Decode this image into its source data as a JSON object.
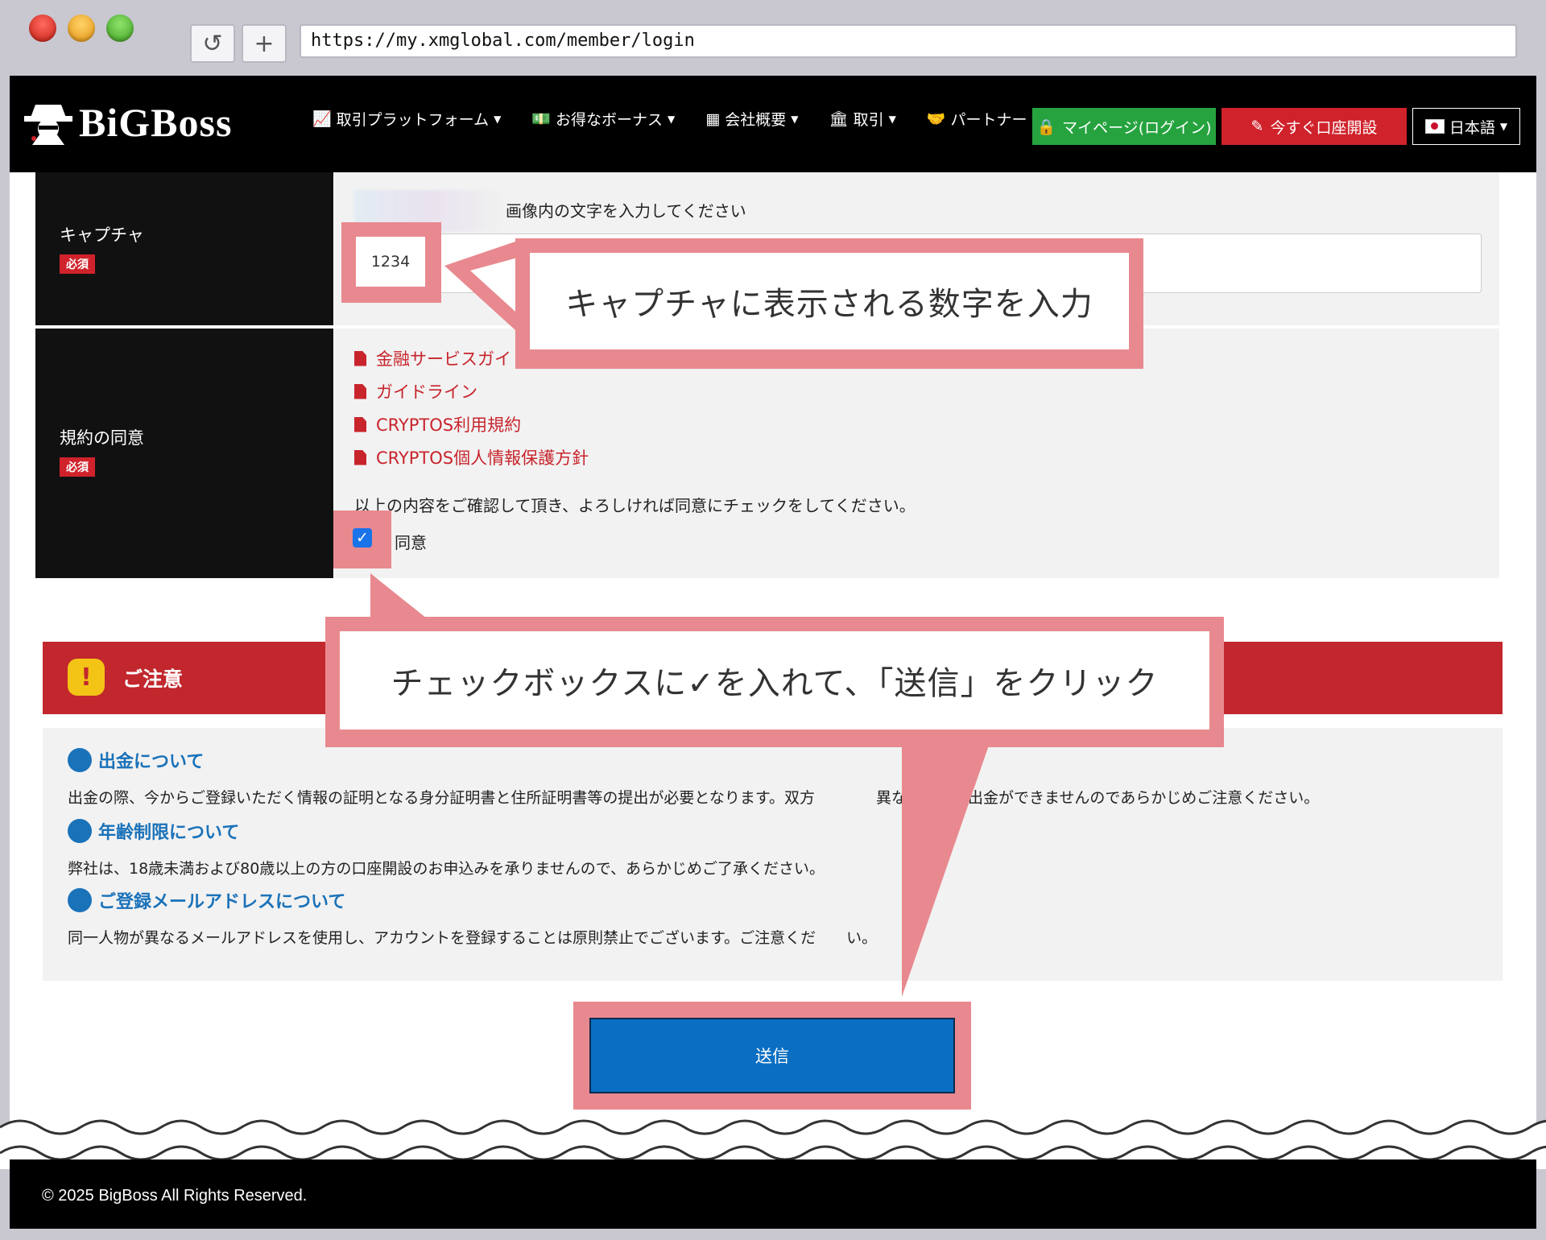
{
  "browser": {
    "url": "https://my.xmglobal.com/member/login"
  },
  "header": {
    "logo_text": "BiGBoss",
    "menu": [
      {
        "label": "取引プラットフォーム",
        "icon": "chart-line-icon"
      },
      {
        "label": "お得なボーナス",
        "icon": "money-icon"
      },
      {
        "label": "会社概要",
        "icon": "building-icon"
      },
      {
        "label": "取引",
        "icon": "bank-icon"
      },
      {
        "label": "パートナー",
        "icon": "handshake-icon"
      }
    ],
    "mypage_label": "マイページ(ログイン)",
    "open_account_label": "今すぐ口座開設",
    "language_label": "日本語"
  },
  "form": {
    "captcha": {
      "label": "キャプチャ",
      "required": "必須",
      "hint": "画像内の文字を入力してください",
      "value": "1234"
    },
    "terms": {
      "label": "規約の同意",
      "required": "必須",
      "links": [
        "金融サービスガイ",
        "ガイドライン",
        "CRYPTOS利用規約",
        "CRYPTOS個人情報保護方針"
      ],
      "instruction": "以上の内容をご確認して頂き、よろしければ同意にチェックをしてください。",
      "agree_label": "同意",
      "agree_checked": true
    }
  },
  "notice": {
    "title": "ご注意",
    "sections": [
      {
        "heading": "出金について",
        "text": "出金の際、今からご登録いただく情報の証明となる身分証明書と住所証明書等の提出が必要となります。双方　　　　異なる場合、出金ができませんのであらかじめご注意ください。"
      },
      {
        "heading": "年齢制限について",
        "text": "弊社は、18歳未満および80歳以上の方の口座開設のお申込みを承りませんので、あらかじめご了承ください。"
      },
      {
        "heading": "ご登録メールアドレスについて",
        "text": "同一人物が異なるメールアドレスを使用し、アカウントを登録することは原則禁止でございます。ご注意くだ　　い。"
      }
    ]
  },
  "submit_label": "送信",
  "callouts": {
    "captcha": "キャプチャに表示される数字を入力",
    "checkbox": "チェックボックスに✓を入れて、「送信」をクリック"
  },
  "footer": {
    "copyright": "© 2025 BigBoss All Rights Reserved."
  },
  "colors": {
    "highlight": "#e8898f",
    "brand_red": "#d0222b",
    "link_red": "#c8242c",
    "accent_blue": "#1a72b9",
    "mypage_green": "#26a33f",
    "submit_blue": "#0a6fc2"
  }
}
